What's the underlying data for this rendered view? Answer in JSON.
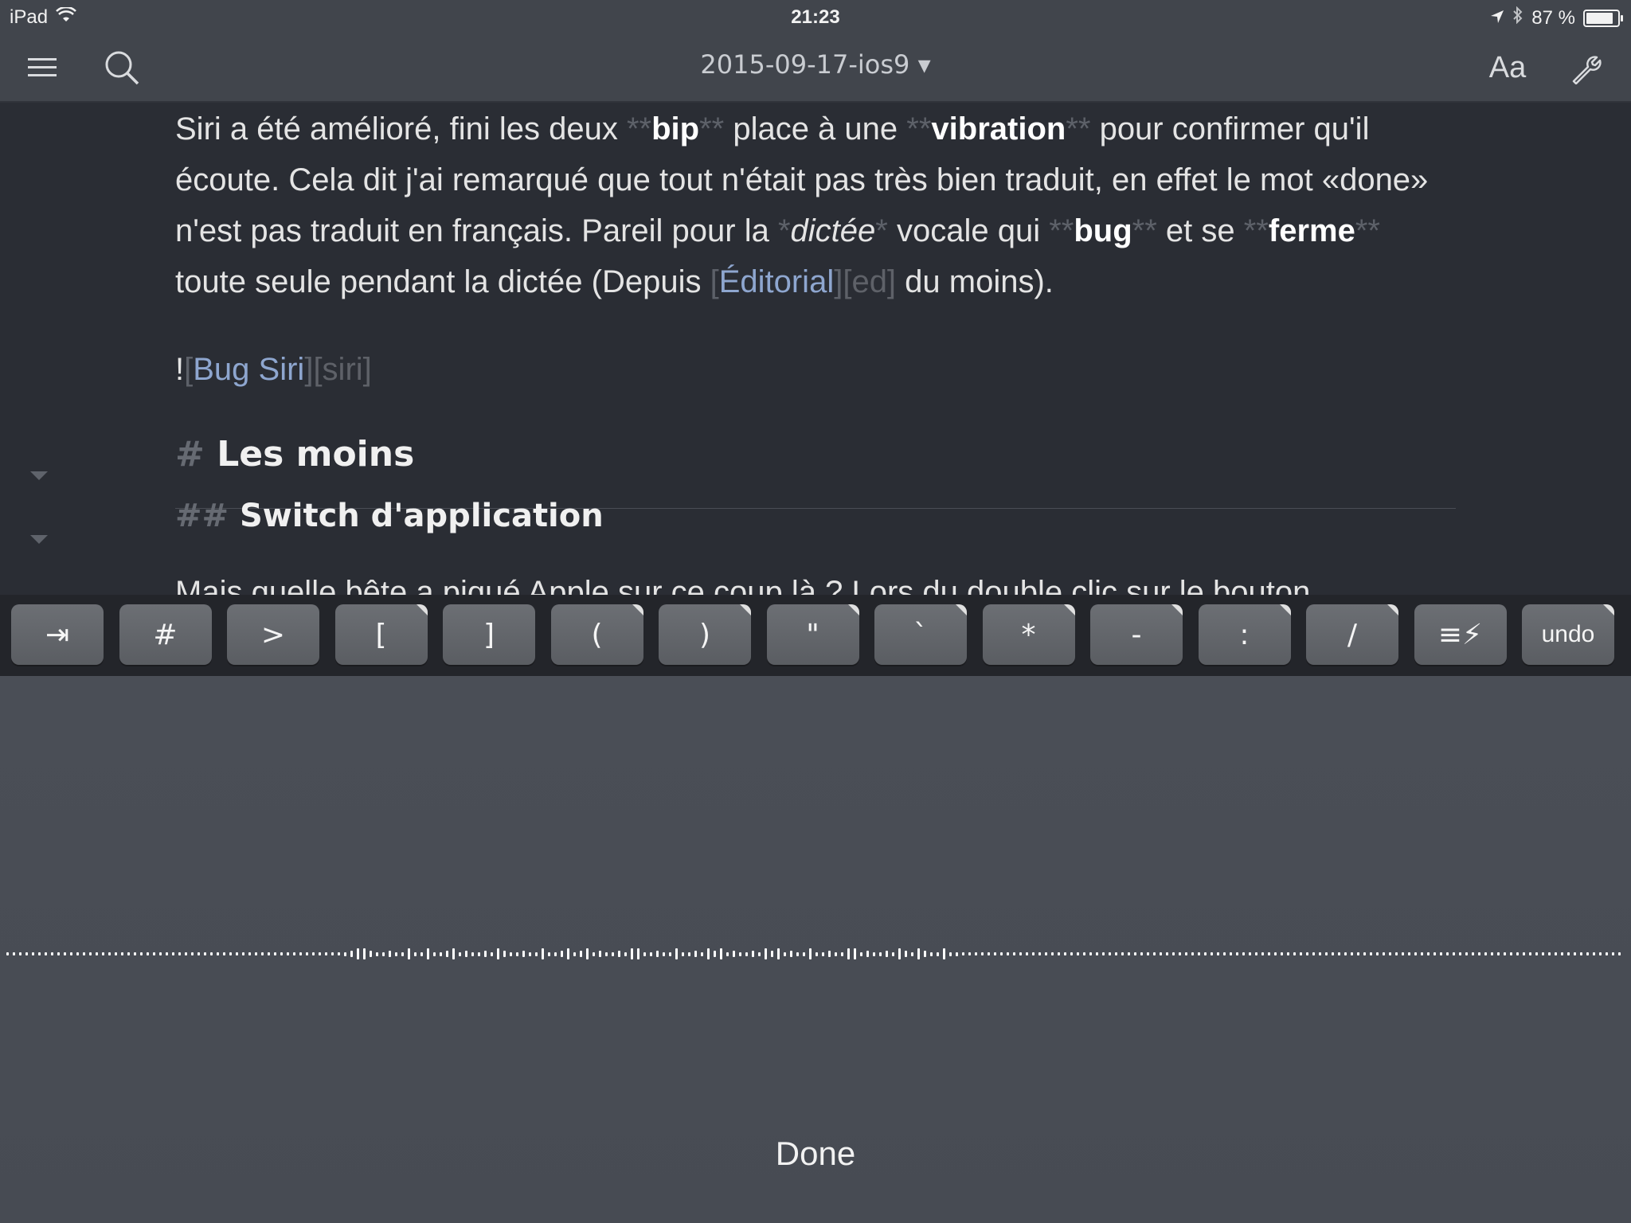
{
  "status_bar": {
    "device": "iPad",
    "time": "21:23",
    "battery": "87 %",
    "battery_level": 0.87,
    "icons": [
      "wifi-icon",
      "location-arrow-icon",
      "bluetooth-icon",
      "battery-icon"
    ]
  },
  "toolbar": {
    "title": "2015-09-17-ios9",
    "title_arrow": "▾",
    "font_button": "Aa",
    "icons": [
      "menu-icon",
      "search-icon",
      "wrench-icon"
    ]
  },
  "editor": {
    "paragraph": [
      {
        "t": "Siri a été amélioré, fini les deux ",
        "c": "txt"
      },
      {
        "t": "**",
        "c": "syn"
      },
      {
        "t": "bip",
        "c": "b"
      },
      {
        "t": "**",
        "c": "syn"
      },
      {
        "t": " place à une ",
        "c": "txt"
      },
      {
        "t": "**",
        "c": "syn"
      },
      {
        "t": "vibration",
        "c": "b"
      },
      {
        "t": "**",
        "c": "syn"
      },
      {
        "t": " pour confirmer qu'il écoute. Cela dit j'ai remarqué que tout n'était pas très bien traduit, en effet le mot «done» n'est pas traduit en français. Pareil pour la ",
        "c": "txt"
      },
      {
        "t": "*",
        "c": "syn"
      },
      {
        "t": "dictée",
        "c": "i"
      },
      {
        "t": "*",
        "c": "syn"
      },
      {
        "t": " vocale qui ",
        "c": "txt"
      },
      {
        "t": "**",
        "c": "syn"
      },
      {
        "t": "bug",
        "c": "b"
      },
      {
        "t": "**",
        "c": "syn"
      },
      {
        "t": " et se ",
        "c": "txt"
      },
      {
        "t": "**",
        "c": "syn"
      },
      {
        "t": "ferme",
        "c": "b"
      },
      {
        "t": "**",
        "c": "syn"
      },
      {
        "t": " toute seule pendant la dictée (Depuis ",
        "c": "txt"
      },
      {
        "t": "[",
        "c": "syn"
      },
      {
        "t": "Éditorial",
        "c": "lnk"
      },
      {
        "t": "]",
        "c": "syn"
      },
      {
        "t": "[ed]",
        "c": "ref"
      },
      {
        "t": " du moins).",
        "c": "txt"
      }
    ],
    "image_ref": [
      {
        "t": "!",
        "c": "txt"
      },
      {
        "t": "[",
        "c": "syn"
      },
      {
        "t": "Bug Siri",
        "c": "lnk"
      },
      {
        "t": "]",
        "c": "syn"
      },
      {
        "t": "[siri]",
        "c": "ref"
      }
    ],
    "heading1": {
      "mark": "#",
      "text": "Les moins"
    },
    "heading2": {
      "mark": "##",
      "text": "Switch d'application"
    },
    "next_line": "Mais quelle bête a piqué Apple sur ce coup là ? Lors du double clic sur le bouton"
  },
  "accessory_keys": [
    {
      "label": "⇥",
      "name": "tab-key",
      "corner": false
    },
    {
      "label": "#",
      "name": "hash-key",
      "corner": false
    },
    {
      "label": ">",
      "name": "quote-key",
      "corner": false
    },
    {
      "label": "[",
      "name": "open-bracket-key",
      "corner": true
    },
    {
      "label": "]",
      "name": "close-bracket-key",
      "corner": false
    },
    {
      "label": "(",
      "name": "open-paren-key",
      "corner": true
    },
    {
      "label": ")",
      "name": "close-paren-key",
      "corner": true
    },
    {
      "label": "\"",
      "name": "double-quote-key",
      "corner": true
    },
    {
      "label": "`",
      "name": "backtick-key",
      "corner": true
    },
    {
      "label": "*",
      "name": "asterisk-key",
      "corner": true
    },
    {
      "label": "-",
      "name": "dash-key",
      "corner": true
    },
    {
      "label": ":",
      "name": "colon-key",
      "corner": true
    },
    {
      "label": "/",
      "name": "slash-key",
      "corner": true
    },
    {
      "label": "≡⚡",
      "name": "snippets-key",
      "corner": false
    },
    {
      "label": "undo",
      "name": "undo-key",
      "corner": true
    }
  ],
  "dictation": {
    "done_label": "Done"
  },
  "colors": {
    "background": "#2a2d34",
    "toolbar": "#41454c",
    "markdown_syntax": "#5d6169",
    "link": "#8ea6cf",
    "dictation_panel": "#4a4e56"
  }
}
